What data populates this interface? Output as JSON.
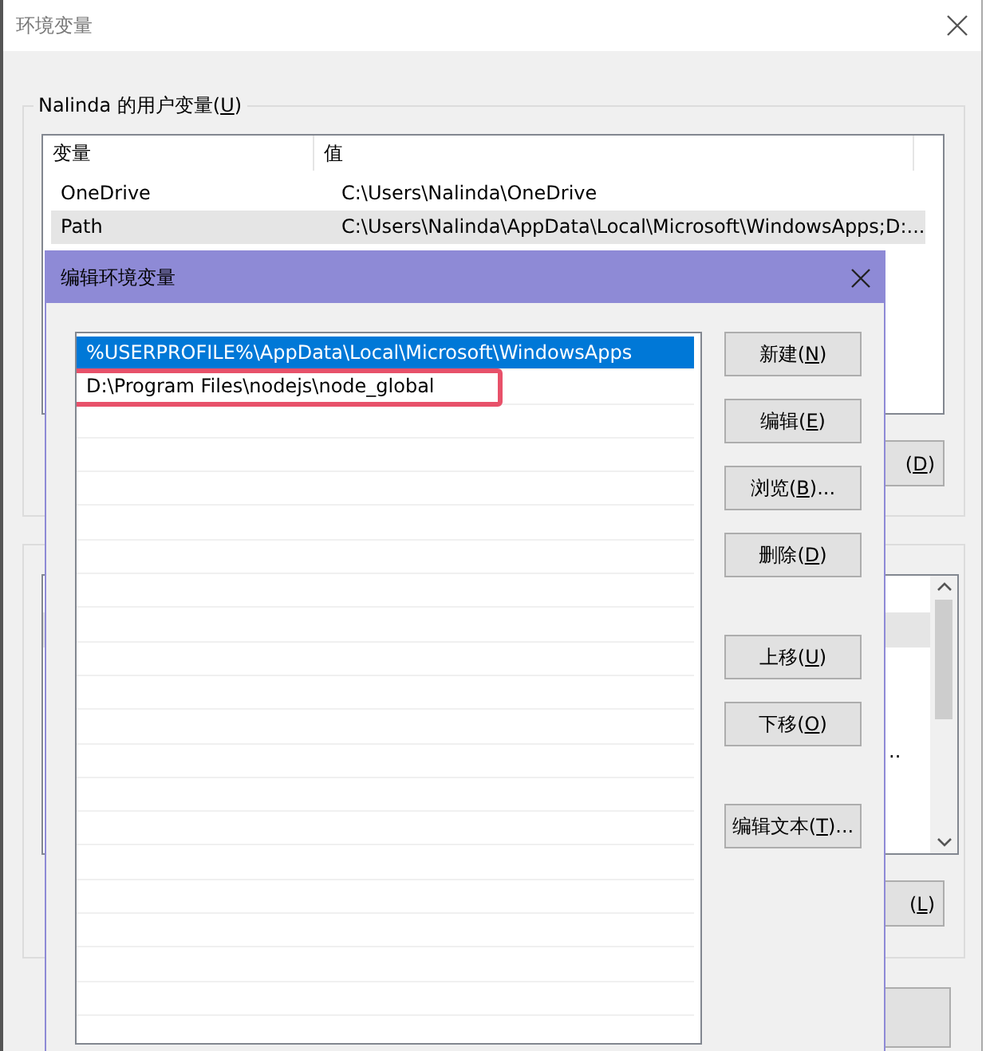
{
  "window": {
    "title": "环境变量"
  },
  "user_vars": {
    "label_before": "Nalinda 的用户变量(",
    "label_key": "U",
    "label_after": ")",
    "columns": [
      "变量",
      "值"
    ],
    "rows": [
      {
        "name": "OneDrive",
        "value": "C:\\Users\\Nalinda\\OneDrive",
        "selected": false
      },
      {
        "name": "Path",
        "value": "C:\\Users\\Nalinda\\AppData\\Local\\Microsoft\\WindowsApps;D:...",
        "selected": true
      }
    ],
    "button": {
      "before": "(",
      "key": "D",
      "after": ")"
    }
  },
  "system_vars": {
    "rows": [
      {
        "selected": true
      },
      {
        "value": "..",
        "selected": false
      }
    ],
    "button": {
      "before": "(",
      "key": "L",
      "after": ")"
    }
  },
  "dialog": {
    "title": "编辑环境变量",
    "items": [
      {
        "text": "%USERPROFILE%\\AppData\\Local\\Microsoft\\WindowsApps",
        "selected": true,
        "highlighted": false
      },
      {
        "text": "D:\\Program Files\\nodejs\\node_global",
        "selected": false,
        "highlighted": true
      }
    ],
    "button_groups": [
      [
        {
          "before": "新建(",
          "key": "N",
          "after": ")"
        },
        {
          "before": "编辑(",
          "key": "E",
          "after": ")"
        },
        {
          "before": "浏览(",
          "key": "B",
          "after": ")..."
        },
        {
          "before": "删除(",
          "key": "D",
          "after": ")"
        }
      ],
      [
        {
          "before": "上移(",
          "key": "U",
          "after": ")"
        },
        {
          "before": "下移(",
          "key": "O",
          "after": ")"
        }
      ],
      [
        {
          "before": "编辑文本(",
          "key": "T",
          "after": ")..."
        }
      ]
    ]
  }
}
